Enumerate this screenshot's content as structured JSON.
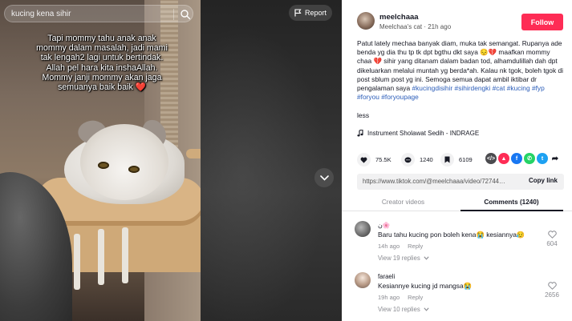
{
  "video": {
    "search_query": "kucing kena sihir",
    "report_label": "Report",
    "caption": "Tapi mommy tahu anak anak mommy dalam masalah, jadi mami tak lengah2 lagi untuk bertindak. Allah pel hara kita inshaAllah. Mommy janji mommy akan jaga semuanya baik baik ❤️"
  },
  "author": {
    "username": "meelchaaa",
    "display_name": "Meelchaa's cat",
    "time_ago": "21h ago",
    "follow_label": "Follow"
  },
  "description": {
    "text": "Patut lately mechaa banyak diam, muka tak semangat. Rupanya ade benda yg dia thu tp tk dpt bgthu dkt saya 😔💔 maafkan mommy chaa 💔 sihir yang ditanam dalam badan tod, alhamdulillah dah dpt dikeluarkan melalui muntah yg berda*ah. Kalau nk tgok, boleh tgok di post sblum post yg ini. Semoga semua dapat ambil iktibar dr pengalaman saya ",
    "hashtags": [
      "#kucingdisihir",
      "#sihirdengki",
      "#cat",
      "#kucing",
      "#fyp",
      "#foryou",
      "#foryoupage"
    ],
    "less_label": "less",
    "music": "Instrument Sholawat Sedih - INDRAGE"
  },
  "actions": {
    "likes": "75.5K",
    "comments": "1240",
    "saves": "6109"
  },
  "share": {
    "link": "https://www.tiktok.com/@meelchaaa/video/72744733...",
    "copy_label": "Copy link"
  },
  "tabs": [
    {
      "label": "Creator videos"
    },
    {
      "label": "Comments (1240)"
    }
  ],
  "comments": [
    {
      "user": "ن🌸",
      "text": "Baru tahu kucing pon boleh kena😭 kesiannya😥",
      "time": "14h ago",
      "reply_label": "Reply",
      "replies": "View 19 replies",
      "likes": "604"
    },
    {
      "user": "faraeli",
      "text": "Kesiannye kucing jd mangsa😭",
      "time": "19h ago",
      "reply_label": "Reply",
      "replies": "View 10 replies",
      "likes": "2656"
    }
  ],
  "colors": {
    "follow": "#fe2c55",
    "hashtag": "#2b5db9",
    "text": "#161823"
  }
}
